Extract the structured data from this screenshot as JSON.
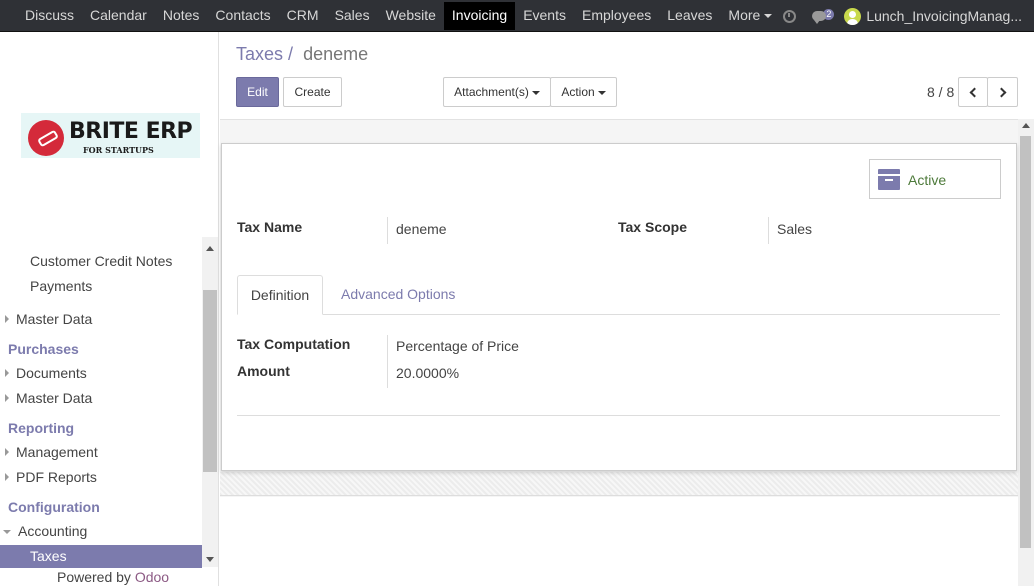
{
  "topbar": {
    "menu": [
      "Discuss",
      "Calendar",
      "Notes",
      "Contacts",
      "CRM",
      "Sales",
      "Website",
      "Invoicing",
      "Events",
      "Employees",
      "Leaves",
      "More"
    ],
    "active_menu": "Invoicing",
    "chat_count": "2",
    "username": "Lunch_InvoicingManag..."
  },
  "sidebar": {
    "logo_title": "BRITE ERP",
    "logo_sub": "FOR STARTUPS",
    "items": [
      {
        "label": "Customer Credit Notes"
      },
      {
        "label": "Payments"
      },
      {
        "label": "Master Data"
      },
      {
        "label": "Purchases"
      },
      {
        "label": "Documents"
      },
      {
        "label": "Master Data"
      },
      {
        "label": "Reporting"
      },
      {
        "label": "Management"
      },
      {
        "label": "PDF Reports"
      },
      {
        "label": "Configuration"
      },
      {
        "label": "Accounting"
      },
      {
        "label": "Taxes"
      }
    ],
    "powered_by": "Powered by",
    "powered_brand": "Odoo"
  },
  "control": {
    "breadcrumb_parent": "Taxes",
    "breadcrumb_sep": "/",
    "breadcrumb_current": "deneme",
    "edit_label": "Edit",
    "create_label": "Create",
    "attachments_label": "Attachment(s)",
    "action_label": "Action",
    "pager": "8 / 8"
  },
  "form": {
    "active_label": "Active",
    "tax_name_label": "Tax Name",
    "tax_name_value": "deneme",
    "tax_scope_label": "Tax Scope",
    "tax_scope_value": "Sales",
    "tabs": [
      "Definition",
      "Advanced Options"
    ],
    "tax_computation_label": "Tax Computation",
    "tax_computation_value": "Percentage of Price",
    "amount_label": "Amount",
    "amount_value": "20.0000%"
  },
  "colors": {
    "accent": "#7c7bad",
    "topbar": "#2f3136",
    "active_green": "#4d7a3a"
  }
}
